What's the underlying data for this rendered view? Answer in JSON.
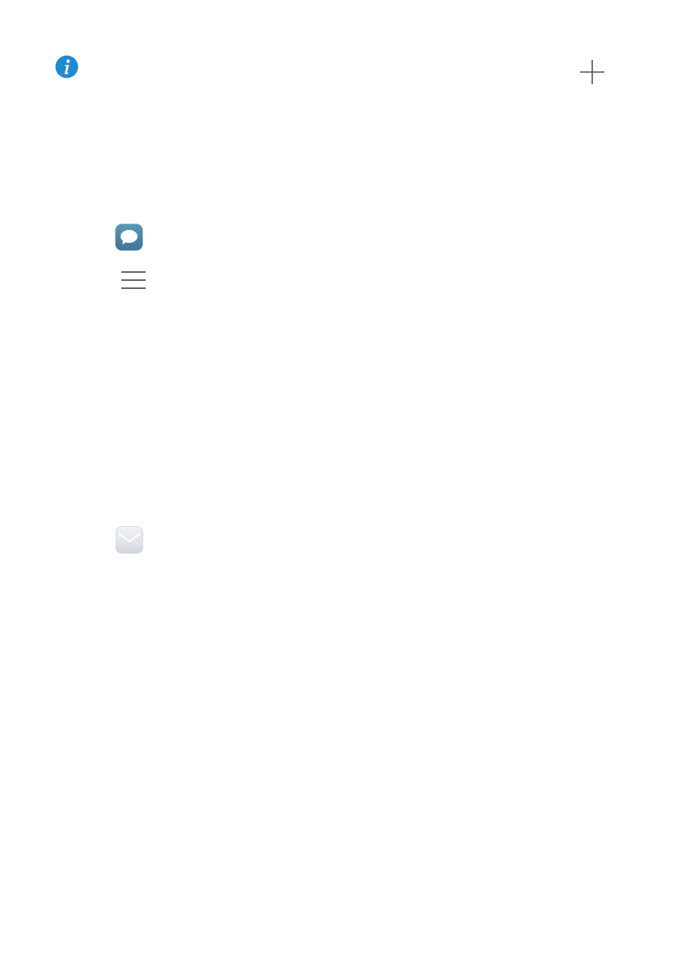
{
  "icons": {
    "info": {
      "name": "info-icon",
      "color": "#1f8ad0"
    },
    "plus": {
      "name": "plus-icon",
      "color": "#555555"
    },
    "messaging": {
      "name": "messaging-app-icon",
      "color": "#4a86a8"
    },
    "menu": {
      "name": "menu-icon",
      "color": "#333333"
    },
    "email": {
      "name": "email-app-icon",
      "color": "#dfe4ea"
    }
  }
}
